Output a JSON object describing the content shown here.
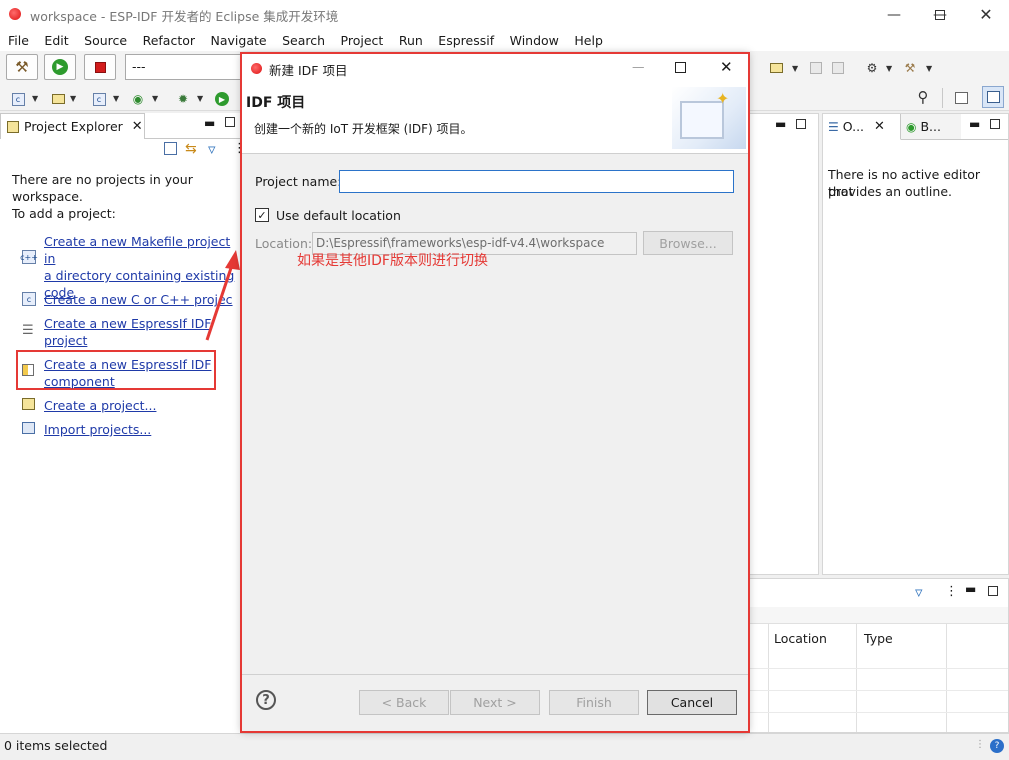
{
  "window": {
    "title": "workspace - ESP-IDF 开发者的 Eclipse 集成开发环境",
    "minimize_icon": "minimize-icon",
    "maximize_icon": "maximize-icon",
    "close_icon": "close-icon"
  },
  "menu": [
    "File",
    "Edit",
    "Source",
    "Refactor",
    "Navigate",
    "Search",
    "Project",
    "Run",
    "Espressif",
    "Window",
    "Help"
  ],
  "toolbar": {
    "launch_config_value": "---"
  },
  "explorer": {
    "tab_label": "Project Explorer",
    "intro_line1": "There are no projects in your",
    "intro_line2": "workspace.",
    "intro_line3": "To add a project:",
    "links": [
      {
        "line1": "Create a new Makefile project in",
        "line2": "a directory containing existing",
        "line3": "code"
      },
      {
        "line1": "Create a new C or C++ projec"
      },
      {
        "line1": "Create a new EspressIf IDF",
        "line2": "project"
      },
      {
        "line1": "Create a new EspressIf IDF",
        "line2": "component"
      },
      {
        "line1": "Create a project..."
      },
      {
        "line1": "Import projects..."
      }
    ]
  },
  "outline": {
    "tab1_label": "O...",
    "tab2_label": "B...",
    "message_line1": "There is no active editor that",
    "message_line2": "provides an outline."
  },
  "bottom_panel": {
    "columns": [
      "Location",
      "Type"
    ]
  },
  "status": {
    "selection": "0 items selected"
  },
  "dialog": {
    "title": "新建 IDF 项目",
    "banner_title": "IDF 项目",
    "banner_subtitle": "创建一个新的 IoT 开发框架 (IDF) 项目。",
    "project_name_label": "Project name:",
    "project_name_value": "",
    "use_default_label": "Use default location",
    "use_default_checked": true,
    "location_label": "Location:",
    "location_value": "D:\\Espressif\\frameworks\\esp-idf-v4.4\\workspace",
    "browse_label": "Browse...",
    "annotation": "如果是其他IDF版本则进行切换",
    "back_label": "< Back",
    "next_label": "Next >",
    "finish_label": "Finish",
    "cancel_label": "Cancel"
  },
  "colors": {
    "annotation_red": "#e53935",
    "link_blue": "#1f3aa8",
    "focus_blue": "#2b73c9"
  }
}
